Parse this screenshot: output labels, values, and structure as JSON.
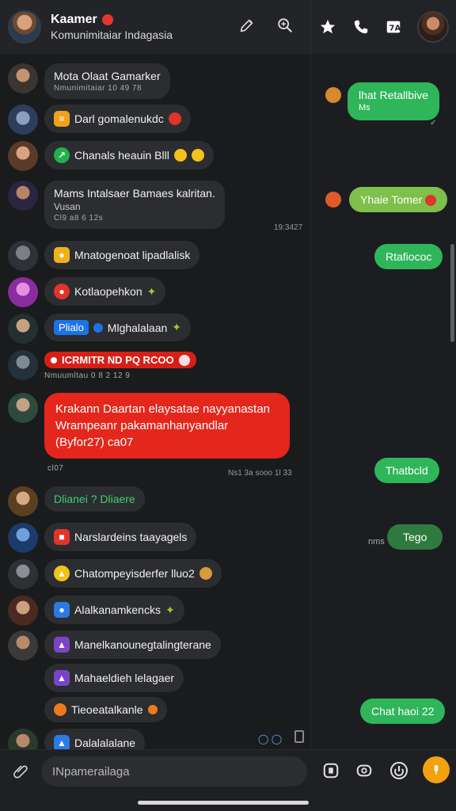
{
  "header": {
    "title": "Kaamer",
    "subtitle": "Komunimitaiar Indagasia"
  },
  "messages": [
    {
      "text": "Mota Olaat Gamarker",
      "meta": "Nmunimitaiar 10 49 78",
      "icon_color": ""
    },
    {
      "text": "Darl gomalenukdc",
      "icon_color": "#f0a21a"
    },
    {
      "text": "Chanals heauin Blll",
      "icon_color": "#22b04a"
    },
    {
      "text": "Mams Intalsaer Bamaes kalritan.",
      "line2": "Vusan",
      "meta": "Cl9 a8 6 12s"
    },
    {
      "text": "Mnatogenoat lipadlalisk",
      "icon_color": "#f0b21a"
    },
    {
      "text": "Kotlaopehkon",
      "icon_color": "#e0342b"
    },
    {
      "text": "Mlghalalaan",
      "tag": "Plialo"
    },
    {
      "text": "ICRMITR ND PQ RCOO",
      "meta": "Nmuumltau 0 8 2 12 9"
    },
    {
      "text": "Krakann Daartan elaysatae nayyanastan Wrampeanr pakamanhanyandlar (Byfor27) ca07",
      "meta": "cl07"
    },
    {
      "text": "Dlianei ? Dliaere"
    },
    {
      "text": "Narslardeins taayagels",
      "icon_color": "#e0342b"
    },
    {
      "text": "Chatompeyisderfer lluo2",
      "icon_color": "#f3c21a"
    },
    {
      "text": "Alalkanamkencks",
      "icon_color": "#2a7be4"
    },
    {
      "text": "Manelkanounegtalingterane",
      "icon_color": "#7b44c7"
    },
    {
      "text": "Mahaeldieh lelagaer",
      "icon_color": "#7b44c7"
    },
    {
      "text": "Tieoeatalkanle",
      "icon_color": "#f07a1a"
    },
    {
      "text": "Dalalalalane",
      "icon_color": "#2a7be4"
    }
  ],
  "timestamps": {
    "t1": "19:3427",
    "t2": "Ns1 3a sooo 1l 33",
    "t3": "nms"
  },
  "right_bubbles": [
    {
      "text": "lhat Retallbive",
      "line2": "Ms",
      "color": "#2fb55a"
    },
    {
      "text": "Yhaie Tomer",
      "color": "#7fbf4b"
    },
    {
      "text": "Rtafiococ",
      "color": "#2fb55a"
    },
    {
      "text": "Thatbcld",
      "color": "#2fb55a"
    },
    {
      "text": "Tego",
      "color": "#2f7a3f"
    },
    {
      "text": "Chat haoi 22",
      "color": "#2fb55a"
    }
  ],
  "composer": {
    "placeholder": "INpamerailaga"
  },
  "icons": {
    "top_left_actions": [
      "attach-pen-icon",
      "search-icon"
    ],
    "top_right_actions": [
      "star-icon",
      "phone-icon",
      "video-icon"
    ],
    "bottom_actions": [
      "paperclip-icon",
      "sticker-icon",
      "camera-icon",
      "power-icon",
      "mic-icon"
    ]
  },
  "colors": {
    "accent_green": "#2fb55a",
    "accent_red": "#e5261c",
    "mic_orange": "#f2a20f"
  }
}
